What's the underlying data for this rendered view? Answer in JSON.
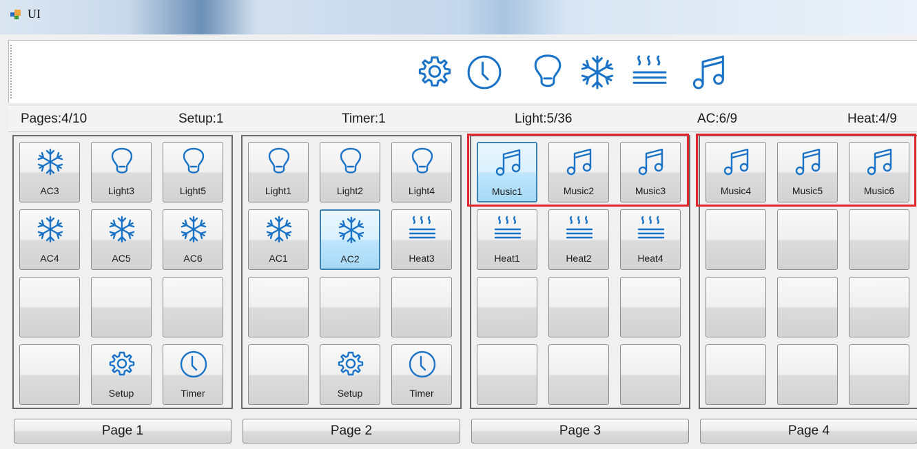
{
  "window": {
    "title": "UI",
    "icon": "app-window-icon"
  },
  "toolbar": {
    "icons": [
      "gear-icon",
      "clock-icon",
      "lightbulb-icon",
      "snowflake-icon",
      "heat-icon",
      "music-icon"
    ]
  },
  "status": {
    "pages": "Pages:4/10",
    "setup": "Setup:1",
    "timer": "Timer:1",
    "light": "Light:5/36",
    "ac": "AC:6/9",
    "heat": "Heat:4/9"
  },
  "colors": {
    "icon": "#1a73c7",
    "highlight": "#e0262c",
    "selected": "#3c7fb1"
  },
  "pages": [
    {
      "label": "Page 1",
      "slots": [
        {
          "icon": "snowflake-icon",
          "label": "AC3"
        },
        {
          "icon": "lightbulb-icon",
          "label": "Light3"
        },
        {
          "icon": "lightbulb-icon",
          "label": "Light5"
        },
        {
          "icon": "snowflake-icon",
          "label": "AC4"
        },
        {
          "icon": "snowflake-icon",
          "label": "AC5"
        },
        {
          "icon": "snowflake-icon",
          "label": "AC6"
        },
        {
          "icon": "",
          "label": ""
        },
        {
          "icon": "",
          "label": ""
        },
        {
          "icon": "",
          "label": ""
        },
        {
          "icon": "",
          "label": ""
        },
        {
          "icon": "gear-icon",
          "label": "Setup"
        },
        {
          "icon": "clock-icon",
          "label": "Timer"
        }
      ]
    },
    {
      "label": "Page 2",
      "slots": [
        {
          "icon": "lightbulb-icon",
          "label": "Light1"
        },
        {
          "icon": "lightbulb-icon",
          "label": "Light2"
        },
        {
          "icon": "lightbulb-icon",
          "label": "Light4"
        },
        {
          "icon": "snowflake-icon",
          "label": "AC1"
        },
        {
          "icon": "snowflake-icon",
          "label": "AC2",
          "selected": true
        },
        {
          "icon": "heat-icon",
          "label": "Heat3"
        },
        {
          "icon": "",
          "label": ""
        },
        {
          "icon": "",
          "label": ""
        },
        {
          "icon": "",
          "label": ""
        },
        {
          "icon": "",
          "label": ""
        },
        {
          "icon": "gear-icon",
          "label": "Setup"
        },
        {
          "icon": "clock-icon",
          "label": "Timer"
        }
      ]
    },
    {
      "label": "Page 3",
      "highlight_first_row": true,
      "slots": [
        {
          "icon": "music-icon",
          "label": "Music1",
          "selected": true
        },
        {
          "icon": "music-icon",
          "label": "Music2"
        },
        {
          "icon": "music-icon",
          "label": "Music3"
        },
        {
          "icon": "heat-icon",
          "label": "Heat1"
        },
        {
          "icon": "heat-icon",
          "label": "Heat2"
        },
        {
          "icon": "heat-icon",
          "label": "Heat4"
        },
        {
          "icon": "",
          "label": ""
        },
        {
          "icon": "",
          "label": ""
        },
        {
          "icon": "",
          "label": ""
        },
        {
          "icon": "",
          "label": ""
        },
        {
          "icon": "",
          "label": ""
        },
        {
          "icon": "",
          "label": ""
        }
      ]
    },
    {
      "label": "Page 4",
      "highlight_first_row": true,
      "slots": [
        {
          "icon": "music-icon",
          "label": "Music4"
        },
        {
          "icon": "music-icon",
          "label": "Music5"
        },
        {
          "icon": "music-icon",
          "label": "Music6"
        },
        {
          "icon": "",
          "label": ""
        },
        {
          "icon": "",
          "label": ""
        },
        {
          "icon": "",
          "label": ""
        },
        {
          "icon": "",
          "label": ""
        },
        {
          "icon": "",
          "label": ""
        },
        {
          "icon": "",
          "label": ""
        },
        {
          "icon": "",
          "label": ""
        },
        {
          "icon": "",
          "label": ""
        },
        {
          "icon": "",
          "label": ""
        }
      ]
    }
  ]
}
